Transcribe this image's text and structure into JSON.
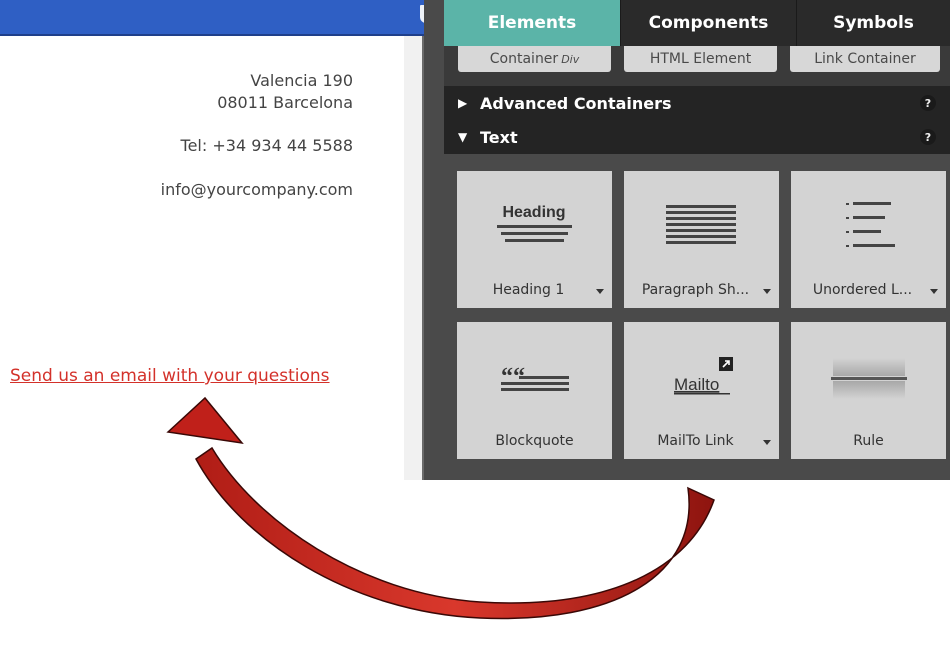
{
  "canvas": {
    "address_street": "Valencia 190",
    "address_city": "08011 Barcelona",
    "phone": "Tel: +34 934 44 5588",
    "email": "info@yourcompany.com",
    "email_link": "Send us an email with your questions",
    "link_color": "#d3312a"
  },
  "panel": {
    "tabs": [
      "Elements",
      "Components",
      "Symbols"
    ],
    "active_tab_color": "#5bb4a8",
    "peek_items": [
      {
        "label": "Container",
        "suffix": "Div"
      },
      {
        "label": "HTML Element",
        "suffix": ""
      },
      {
        "label": "Link Container",
        "suffix": ""
      }
    ],
    "sections": [
      {
        "label": "Advanced Containers",
        "state": "collapsed",
        "help": "?"
      },
      {
        "label": "Text",
        "state": "expanded",
        "help": "?"
      }
    ],
    "tiles": [
      {
        "label": "Heading 1",
        "icon": "heading-icon",
        "icon_text": "Heading",
        "dropdown": true
      },
      {
        "label": "Paragraph Sh...",
        "icon": "paragraph-icon",
        "dropdown": true
      },
      {
        "label": "Unordered L...",
        "icon": "unordered-list-icon",
        "dropdown": true
      },
      {
        "label": "Blockquote",
        "icon": "blockquote-icon",
        "icon_text": "““",
        "dropdown": false
      },
      {
        "label": "MailTo Link",
        "icon": "mailto-icon",
        "icon_text": "Mailto",
        "dropdown": true
      },
      {
        "label": "Rule",
        "icon": "rule-icon",
        "dropdown": false
      }
    ]
  },
  "annotation": {
    "arrow": "curved-red-arrow",
    "color": "#c0201a"
  }
}
